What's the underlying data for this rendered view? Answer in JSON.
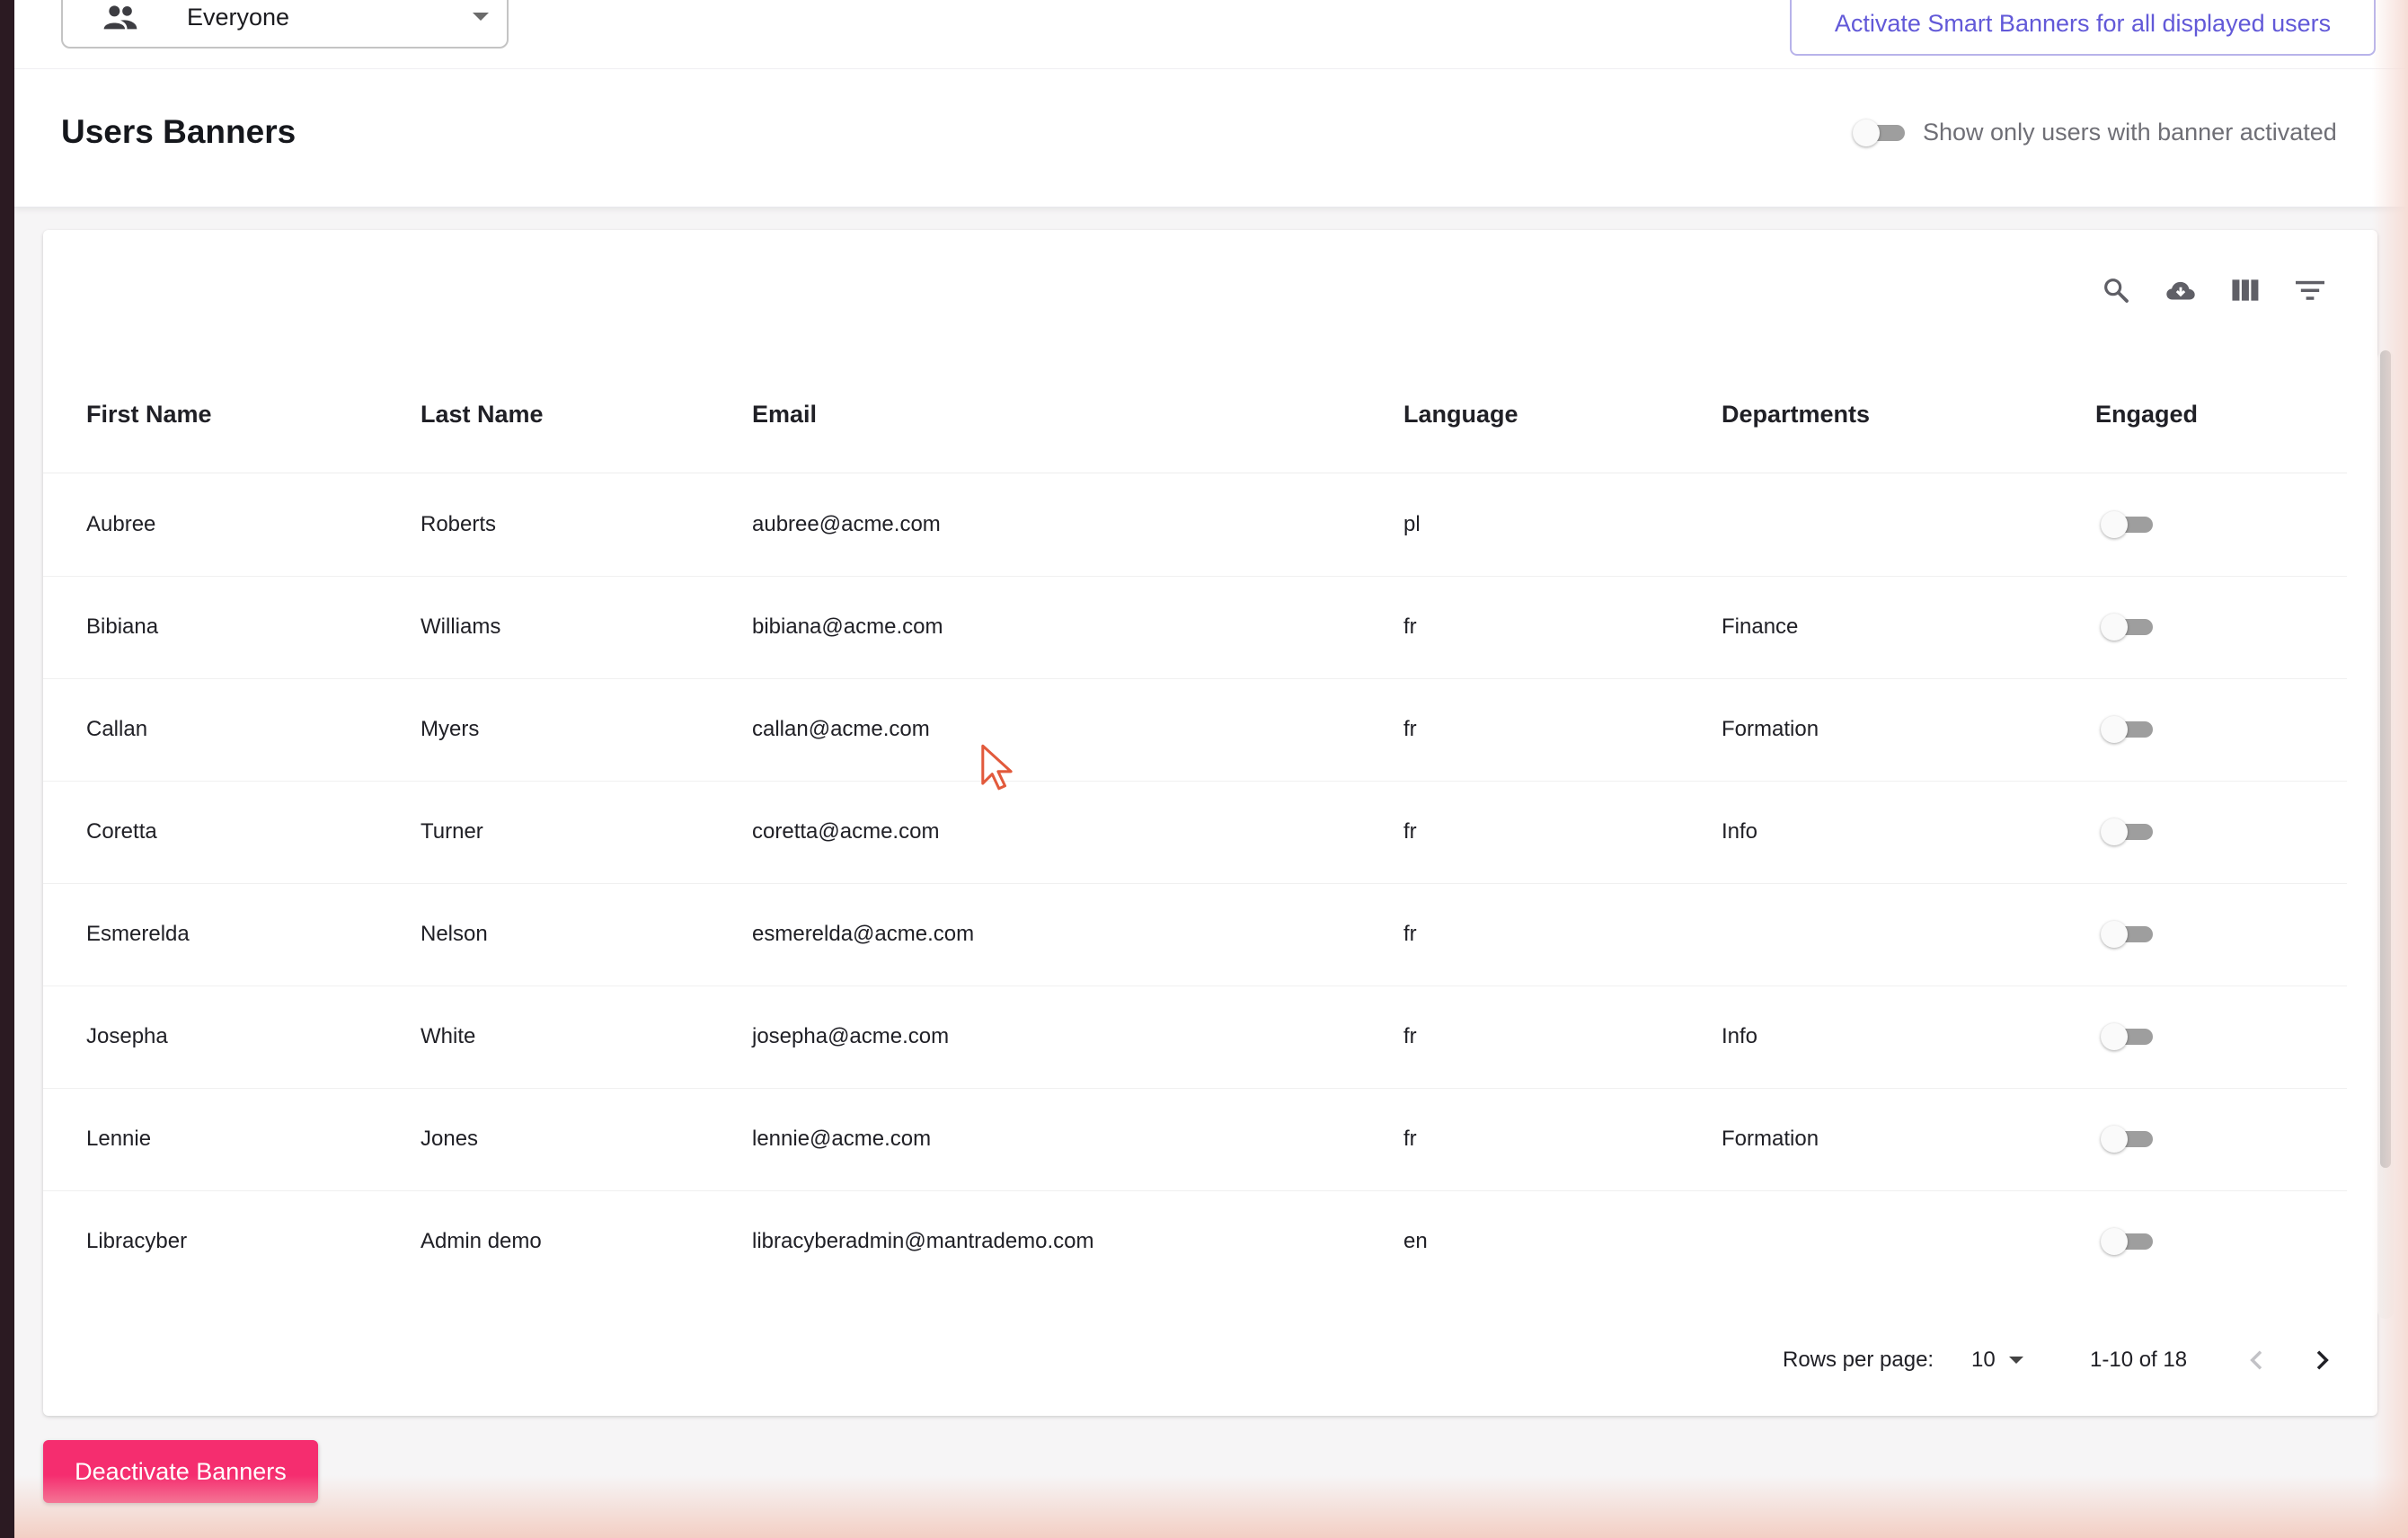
{
  "header": {
    "audience_select": {
      "value": "Everyone",
      "icon": "people-icon"
    },
    "activate_button": "Activate Smart Banners for all displayed users",
    "title": "Users Banners",
    "filter_toggle": {
      "label": "Show only users with banner activated",
      "checked": false
    }
  },
  "toolbar": {
    "icons": [
      "search-icon",
      "cloud-download-icon",
      "view-columns-icon",
      "filter-list-icon"
    ]
  },
  "table": {
    "columns": [
      "First Name",
      "Last Name",
      "Email",
      "Language",
      "Departments",
      "Engaged"
    ],
    "rows": [
      {
        "first": "Aubree",
        "last": "Roberts",
        "email": "aubree@acme.com",
        "lang": "pl",
        "dept": "",
        "engaged": false
      },
      {
        "first": "Bibiana",
        "last": "Williams",
        "email": "bibiana@acme.com",
        "lang": "fr",
        "dept": "Finance",
        "engaged": false
      },
      {
        "first": "Callan",
        "last": "Myers",
        "email": "callan@acme.com",
        "lang": "fr",
        "dept": "Formation",
        "engaged": false
      },
      {
        "first": "Coretta",
        "last": "Turner",
        "email": "coretta@acme.com",
        "lang": "fr",
        "dept": "Info",
        "engaged": false
      },
      {
        "first": "Esmerelda",
        "last": "Nelson",
        "email": "esmerelda@acme.com",
        "lang": "fr",
        "dept": "",
        "engaged": false
      },
      {
        "first": "Josepha",
        "last": "White",
        "email": "josepha@acme.com",
        "lang": "fr",
        "dept": "Info",
        "engaged": false
      },
      {
        "first": "Lennie",
        "last": "Jones",
        "email": "lennie@acme.com",
        "lang": "fr",
        "dept": "Formation",
        "engaged": false
      },
      {
        "first": "Libracyber",
        "last": "Admin demo",
        "email": "libracyberadmin@mantrademo.com",
        "lang": "en",
        "dept": "",
        "engaged": false
      }
    ]
  },
  "pagination": {
    "rows_per_page_label": "Rows per page:",
    "rows_per_page": "10",
    "range": "1-10 of 18"
  },
  "footer": {
    "deactivate_button": "Deactivate Banners"
  },
  "colors": {
    "accent": "#6259d8",
    "danger": "#f52d6f",
    "toggle_off": "#9e9e9e"
  }
}
